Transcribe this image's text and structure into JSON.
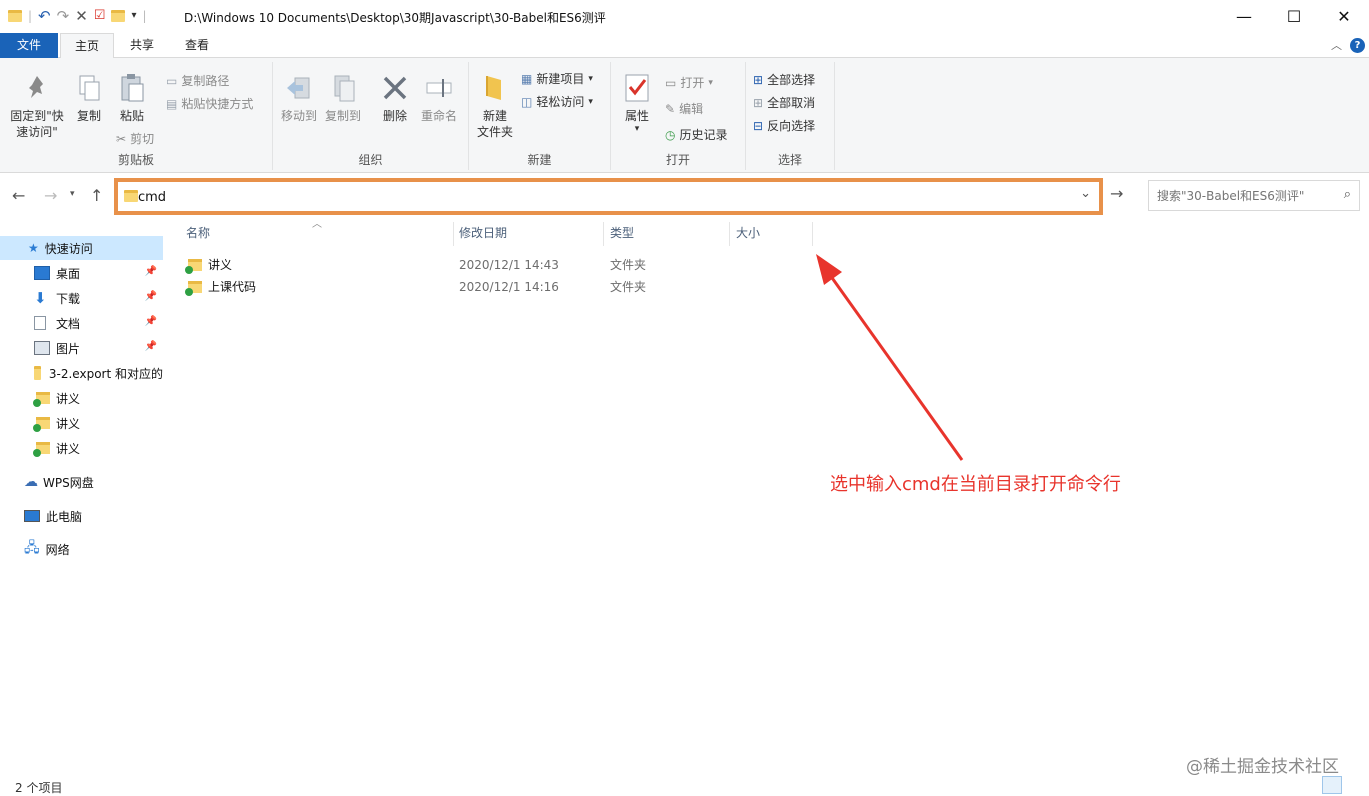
{
  "window": {
    "path": "D:\\Windows 10 Documents\\Desktop\\30期Javascript\\30-Babel和ES6测评",
    "controls": {
      "minimize": "—",
      "maximize": "☐",
      "close": "✕"
    }
  },
  "tabs": [
    "文件",
    "主页",
    "共享",
    "查看"
  ],
  "ribbon": {
    "clipboard": {
      "label": "剪贴板",
      "pin": "固定到\"快速访问\"",
      "copy": "复制",
      "paste": "粘贴",
      "copy_path": "复制路径",
      "paste_shortcut": "粘贴快捷方式",
      "cut": "剪切"
    },
    "organize": {
      "label": "组织",
      "move_to": "移动到",
      "copy_to": "复制到",
      "delete": "删除",
      "rename": "重命名"
    },
    "new": {
      "label": "新建",
      "new_folder": "新建\n文件夹",
      "new_item": "新建项目",
      "easy_access": "轻松访问"
    },
    "open": {
      "label": "打开",
      "properties": "属性",
      "open": "打开",
      "edit": "编辑",
      "history": "历史记录"
    },
    "select": {
      "label": "选择",
      "select_all": "全部选择",
      "select_none": "全部取消",
      "invert": "反向选择"
    }
  },
  "address": {
    "value": "cmd"
  },
  "search": {
    "placeholder": "搜索\"30-Babel和ES6测评\""
  },
  "sidebar": {
    "quick_access": "快速访问",
    "items": [
      {
        "label": "桌面",
        "icon": "desktop-icon",
        "pinned": true
      },
      {
        "label": "下载",
        "icon": "download-icon",
        "pinned": true
      },
      {
        "label": "文档",
        "icon": "document-icon",
        "pinned": true
      },
      {
        "label": "图片",
        "icon": "picture-icon",
        "pinned": true
      },
      {
        "label": "3-2.export 和对应的",
        "icon": "folder-icon",
        "pinned": false
      },
      {
        "label": "讲义",
        "icon": "sync-folder-icon",
        "pinned": false
      },
      {
        "label": "讲义",
        "icon": "sync-folder-icon",
        "pinned": false
      },
      {
        "label": "讲义",
        "icon": "sync-folder-icon",
        "pinned": false
      }
    ],
    "wps": "WPS网盘",
    "this_pc": "此电脑",
    "network": "网络"
  },
  "columns": [
    "名称",
    "修改日期",
    "类型",
    "大小"
  ],
  "files": [
    {
      "name": "讲义",
      "date": "2020/12/1 14:43",
      "type": "文件夹"
    },
    {
      "name": "上课代码",
      "date": "2020/12/1 14:16",
      "type": "文件夹"
    }
  ],
  "annotation": "选中输入cmd在当前目录打开命令行",
  "watermark": "@稀土掘金技术社区",
  "status": "2 个项目",
  "colors": {
    "accent": "#1a63b8",
    "highlight_border": "#e8914a",
    "annotation": "#e8342c"
  }
}
